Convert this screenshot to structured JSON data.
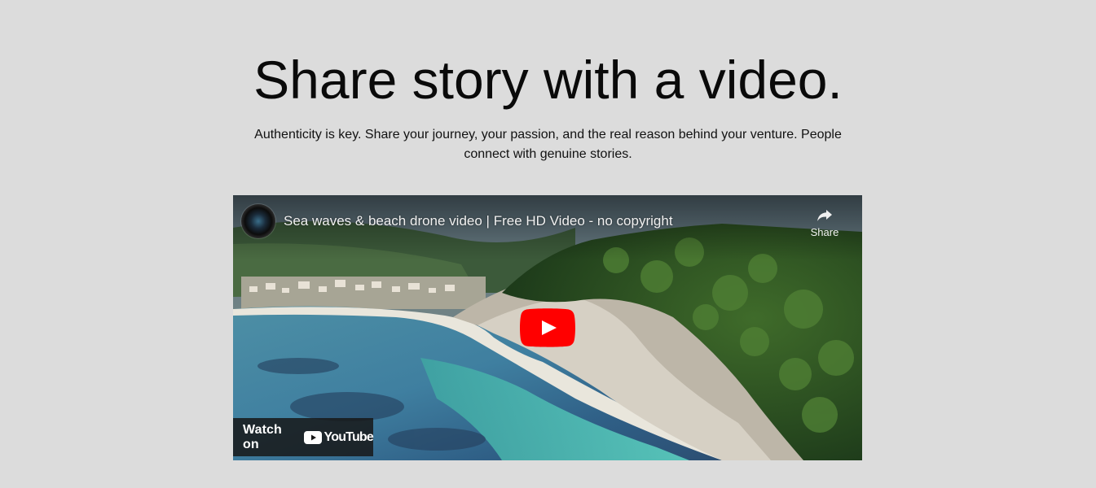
{
  "header": {
    "title": "Share story with a video.",
    "subtitle": "Authenticity is key. Share your journey, your passion, and the real reason behind your venture. People connect with genuine stories."
  },
  "video": {
    "title": "Sea waves & beach drone video | Free HD Video - no copyright",
    "share_label": "Share",
    "watch_on_label": "Watch on",
    "platform_label": "YouTube",
    "play_button_color": "#ff0000"
  },
  "icons": {
    "share": "share-arrow-icon",
    "play": "play-icon",
    "avatar": "camera-lens-avatar",
    "platform_logo": "youtube-logo-icon"
  }
}
